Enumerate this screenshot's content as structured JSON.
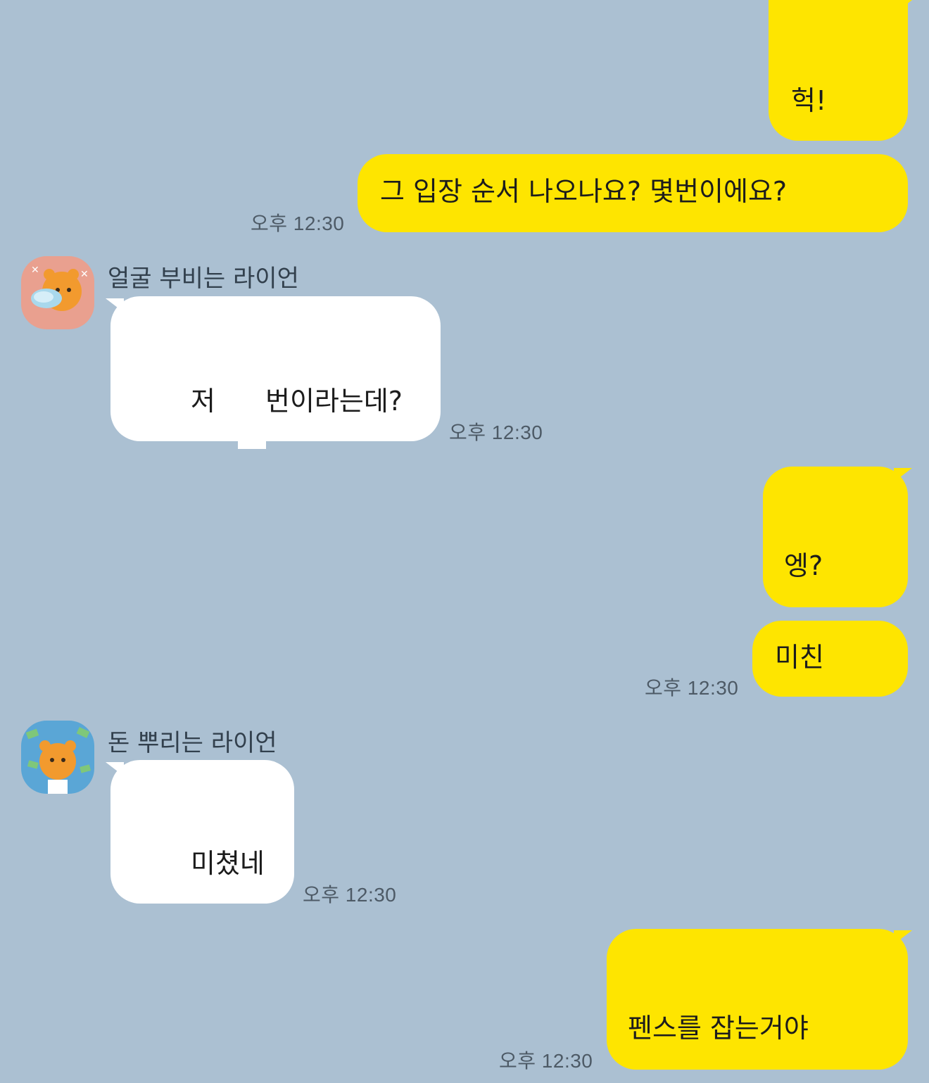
{
  "colors": {
    "background": "#abc0d2",
    "my_bubble": "#fee500",
    "their_bubble": "#ffffff"
  },
  "messages": [
    {
      "side": "me",
      "text": "헉!"
    },
    {
      "side": "me",
      "text": "그 입장 순서 나오나요? 몇번이에요?",
      "time": "오후 12:30"
    },
    {
      "side": "them",
      "sender": "얼굴 부비는 라이언",
      "avatar": "ryan-hugging-pillow-icon",
      "text_before": "저",
      "text_after": "번이라는데?",
      "time": "오후 12:30"
    },
    {
      "side": "me",
      "text": "엥?"
    },
    {
      "side": "me",
      "text": "미친",
      "time": "오후 12:30"
    },
    {
      "side": "them",
      "sender": "돈 뿌리는 라이언",
      "avatar": "ryan-throwing-money-icon",
      "text": "미쳤네",
      "time": "오후 12:30"
    },
    {
      "side": "me",
      "text": "펜스를 잡는거야",
      "time": "오후 12:30"
    }
  ]
}
